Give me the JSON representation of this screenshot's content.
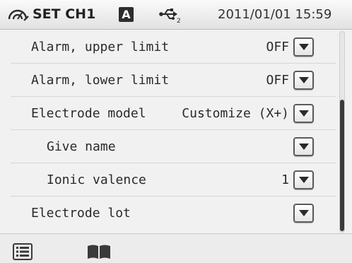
{
  "header": {
    "mode_icon": "gauge-icon",
    "title": "SET CH1",
    "badge": "A",
    "usb_icon": "usb-icon",
    "datetime": "2011/01/01 15:59"
  },
  "settings": [
    {
      "label": "Alarm, upper limit",
      "value": "OFF",
      "indent": false
    },
    {
      "label": "Alarm, lower limit",
      "value": "OFF",
      "indent": false
    },
    {
      "label": "Electrode model",
      "value": "Customize (X+)",
      "indent": false
    },
    {
      "label": "Give name",
      "value": "",
      "indent": true
    },
    {
      "label": "Ionic valence",
      "value": "1",
      "indent": true
    },
    {
      "label": "Electrode lot",
      "value": "",
      "indent": false
    }
  ],
  "footer": {
    "list_icon": "list-icon",
    "book_icon": "book-icon"
  },
  "colors": {
    "background": "#f1f1f1",
    "text": "#2a2a2a",
    "badge": "#2d2d2d",
    "scroll_thumb": "#3a3a3a"
  }
}
